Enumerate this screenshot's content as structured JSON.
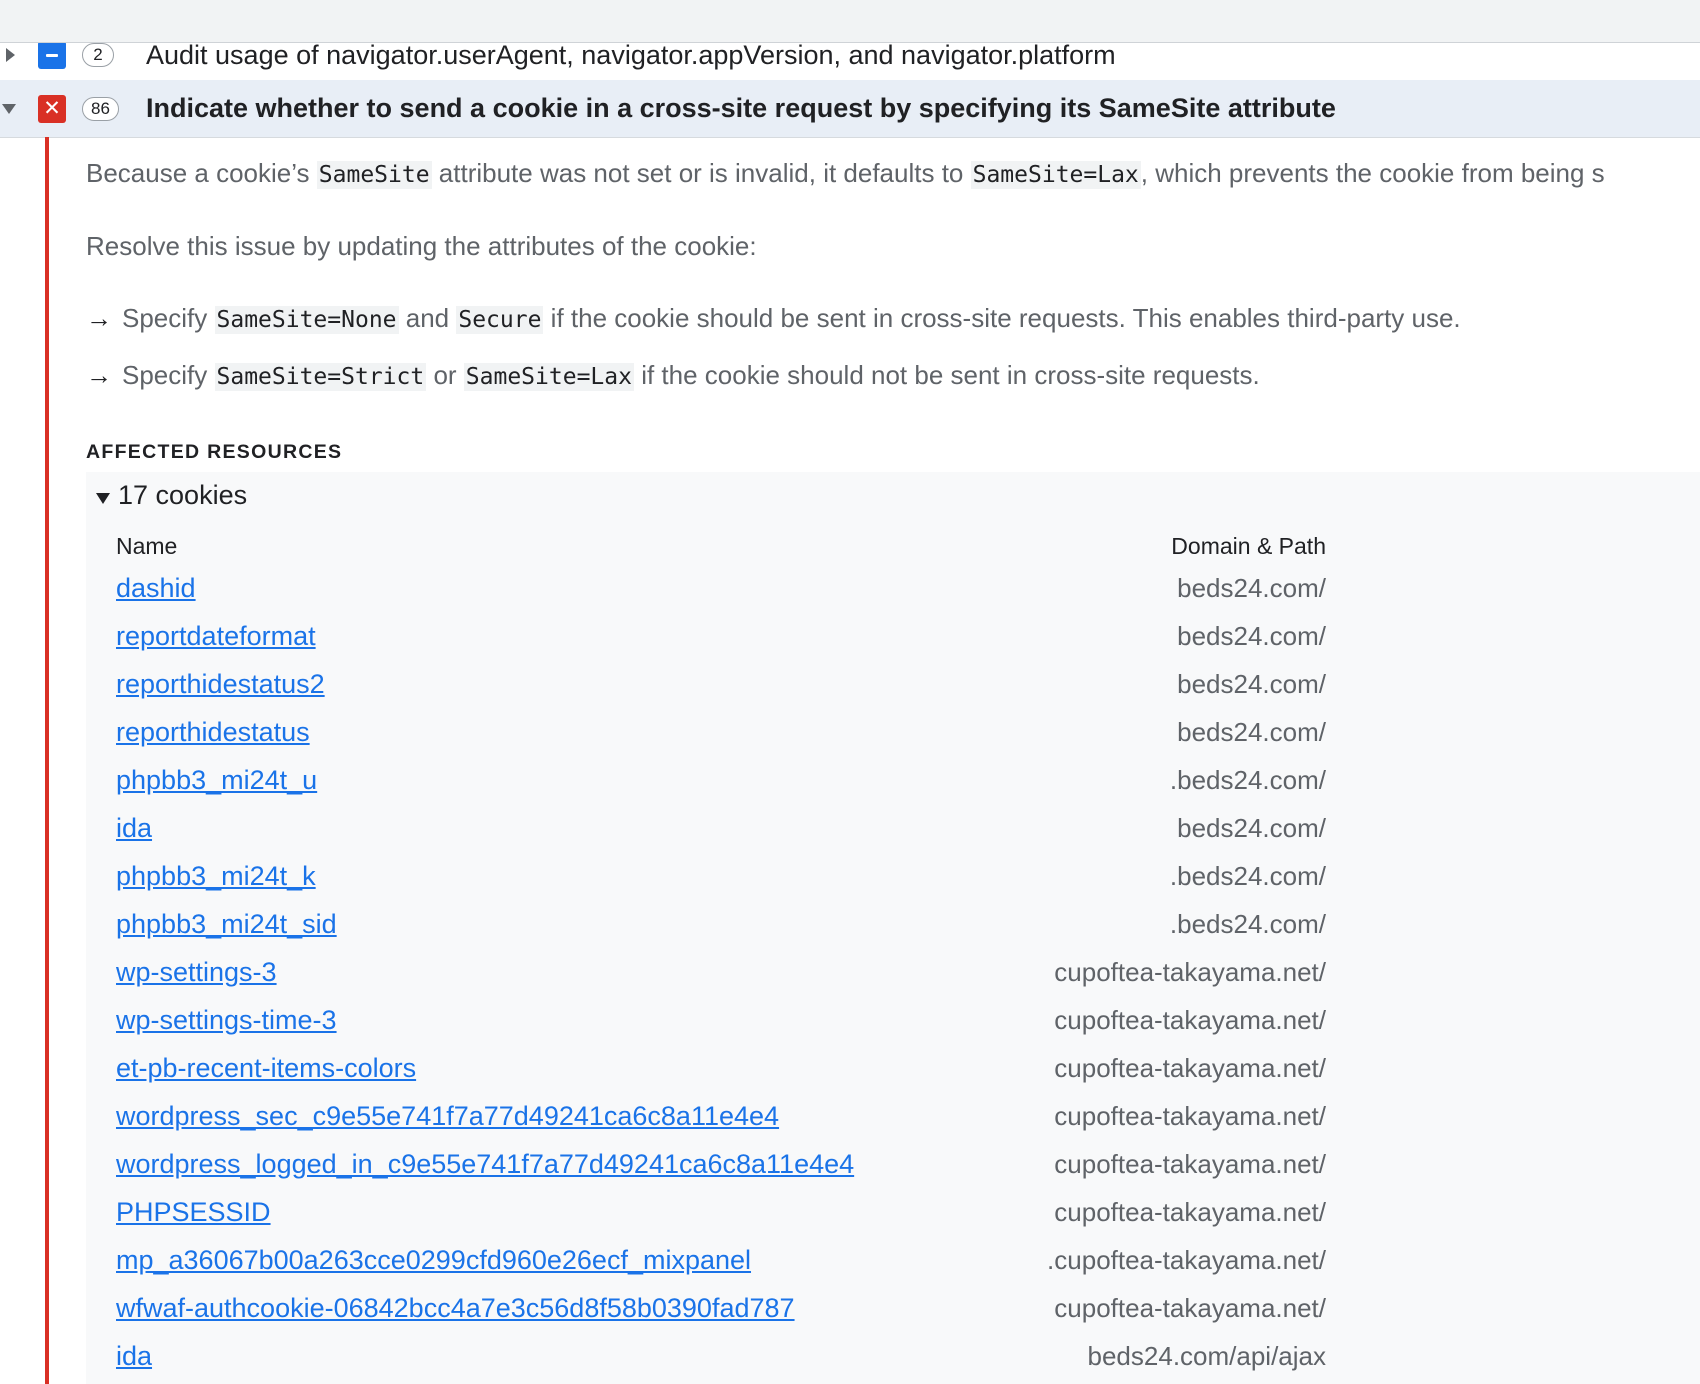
{
  "issues": [
    {
      "severity": "info",
      "count": "2",
      "title": "Audit usage of navigator.userAgent, navigator.appVersion, and navigator.platform",
      "expanded": false
    },
    {
      "severity": "error",
      "count": "86",
      "title": "Indicate whether to send a cookie in a cross-site request by specifying its SameSite attribute",
      "expanded": true
    }
  ],
  "description": {
    "p1": {
      "t1": "Because a cookie’s ",
      "c1": "SameSite",
      "t2": " attribute was not set or is invalid, it defaults to ",
      "c2": "SameSite=Lax",
      "t3": ", which prevents the cookie from being s"
    },
    "p2": "Resolve this issue by updating the attributes of the cookie:",
    "bullet1": {
      "arrow": "→",
      "t1": "Specify ",
      "c1": "SameSite=None",
      "t2": " and ",
      "c2": "Secure",
      "t3": " if the cookie should be sent in cross-site requests. This enables third-party use."
    },
    "bullet2": {
      "arrow": "→",
      "t1": "Specify ",
      "c1": "SameSite=Strict",
      "t2": " or ",
      "c2": "SameSite=Lax",
      "t3": " if the cookie should not be sent in cross-site requests."
    }
  },
  "affected_resources": {
    "label": "AFFECTED RESOURCES",
    "summary": "17 cookies",
    "columns": {
      "name": "Name",
      "domain": "Domain & Path"
    },
    "cookies": [
      {
        "name": "dashid",
        "domain": "beds24.com/"
      },
      {
        "name": "reportdateformat",
        "domain": "beds24.com/"
      },
      {
        "name": "reporthidestatus2",
        "domain": "beds24.com/"
      },
      {
        "name": "reporthidestatus",
        "domain": "beds24.com/"
      },
      {
        "name": "phpbb3_mi24t_u",
        "domain": ".beds24.com/"
      },
      {
        "name": "ida",
        "domain": "beds24.com/"
      },
      {
        "name": "phpbb3_mi24t_k",
        "domain": ".beds24.com/"
      },
      {
        "name": "phpbb3_mi24t_sid",
        "domain": ".beds24.com/"
      },
      {
        "name": "wp-settings-3",
        "domain": "cupoftea-takayama.net/"
      },
      {
        "name": "wp-settings-time-3",
        "domain": "cupoftea-takayama.net/"
      },
      {
        "name": "et-pb-recent-items-colors",
        "domain": "cupoftea-takayama.net/"
      },
      {
        "name": "wordpress_sec_c9e55e741f7a77d49241ca6c8a11e4e4",
        "domain": "cupoftea-takayama.net/"
      },
      {
        "name": "wordpress_logged_in_c9e55e741f7a77d49241ca6c8a11e4e4",
        "domain": "cupoftea-takayama.net/"
      },
      {
        "name": "PHPSESSID",
        "domain": "cupoftea-takayama.net/"
      },
      {
        "name": "mp_a36067b00a263cce0299cfd960e26ecf_mixpanel",
        "domain": ".cupoftea-takayama.net/"
      },
      {
        "name": "wfwaf-authcookie-06842bcc4a7e3c56d8f58b0390fad787",
        "domain": "cupoftea-takayama.net/"
      },
      {
        "name": "ida",
        "domain": "beds24.com/api/ajax"
      }
    ]
  },
  "colors": {
    "link": "#1a73e8",
    "error": "#d93025",
    "info": "#1a73e8",
    "expanded_row_bg": "#e8eef6"
  }
}
